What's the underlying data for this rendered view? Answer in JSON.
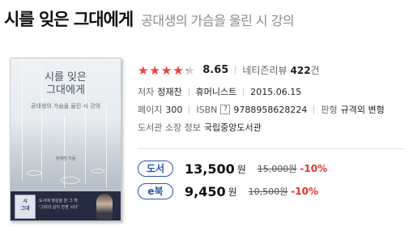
{
  "header": {
    "title": "시를 잊은 그대에게",
    "subtitle": "공대생의 가슴을 울린 시 강의"
  },
  "cover": {
    "title_line1": "시를 잊은",
    "title_line2": "그대에게",
    "subtitle": "공대생의 가슴을 울린 시 강의",
    "author": "정재찬 지음",
    "band_logo_line1": "시",
    "band_logo_line2": "그대",
    "band_text_line1": "도서에 영상을 본 그 책",
    "band_text_line2": "'그대의 삶이 한편 시다'",
    "icons": {
      "rain": "rain-streak",
      "face": "author-portrait"
    }
  },
  "rating": {
    "value": 4.3,
    "max": 5,
    "stars_glyphs": "★★★★★",
    "score": "8.65",
    "review_label": "네티즌리뷰",
    "review_count": "422",
    "review_unit": "건",
    "star_color": "#f23f3b"
  },
  "info": {
    "author_label": "저자",
    "author_value": "정재찬",
    "publisher_value": "휴머니스트",
    "date_value": "2015.06.15",
    "pages_label": "페이지",
    "pages_value": "300",
    "isbn_label": "ISBN",
    "isbn_help": "?",
    "isbn_value": "9788958628224",
    "format_label": "판형",
    "format_value": "규격외 변형",
    "library_label": "도서관 소장 정보",
    "library_value": "국립중앙도서관"
  },
  "prices": [
    {
      "tag": "도서",
      "price": "13,500",
      "unit": "원",
      "original": "15,000원",
      "discount": "-10%"
    },
    {
      "tag": "e북",
      "price": "9,450",
      "unit": "원",
      "original": "10,500원",
      "discount": "-10%"
    }
  ],
  "colors": {
    "tag_blue": "#2c56b0",
    "discount_red": "#e8322c"
  }
}
